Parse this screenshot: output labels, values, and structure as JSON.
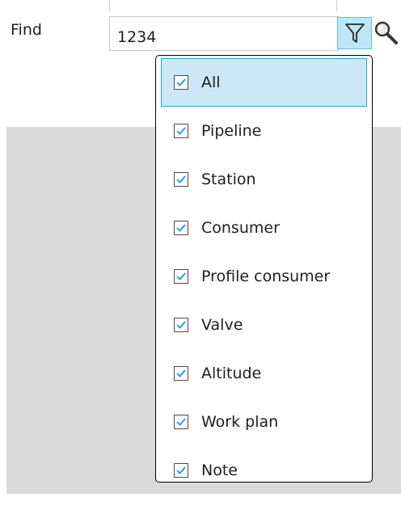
{
  "find": {
    "label": "Find",
    "value": "1234"
  },
  "toolbar": {
    "filter_icon": "filter-icon",
    "search_icon": "search-icon"
  },
  "filter_menu": {
    "items": [
      {
        "label": "All",
        "checked": true,
        "selected": true
      },
      {
        "label": "Pipeline",
        "checked": true,
        "selected": false
      },
      {
        "label": "Station",
        "checked": true,
        "selected": false
      },
      {
        "label": "Consumer",
        "checked": true,
        "selected": false
      },
      {
        "label": "Profile consumer",
        "checked": true,
        "selected": false
      },
      {
        "label": "Valve",
        "checked": true,
        "selected": false
      },
      {
        "label": "Altitude",
        "checked": true,
        "selected": false
      },
      {
        "label": "Work plan",
        "checked": true,
        "selected": false
      },
      {
        "label": "Note",
        "checked": true,
        "selected": false
      }
    ]
  },
  "colors": {
    "accent": "#26a0da",
    "selected_bg": "#cce8f6",
    "check": "#1a9ed8",
    "background_panel": "#dadada"
  }
}
